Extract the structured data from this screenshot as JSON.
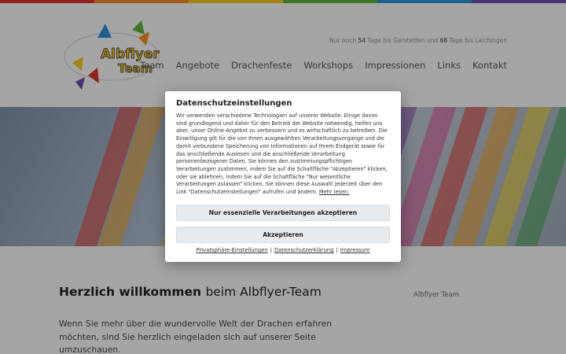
{
  "colors": {
    "rainbow": [
      "#d9322a",
      "#f08a24",
      "#f2c31b",
      "#5fae3a",
      "#2f8fd0",
      "#6b4aa6"
    ],
    "hero_stripes": [
      "#e03a2f",
      "#f3a125",
      "#f2d01c",
      "#3fa34d",
      "#2f7fd0",
      "#8a4ab0",
      "#d94e8f"
    ]
  },
  "header": {
    "logo_text_line1": "Albflyer",
    "logo_text_line2": "Team",
    "countdown": {
      "prefix": "Nur noch",
      "days1": "54",
      "middle": "Tage bis Gerstetten und",
      "days2": "68",
      "suffix": "Tage bis Laichingen"
    },
    "nav": [
      "Team",
      "Angebote",
      "Drachenfeste",
      "Workshops",
      "Impressionen",
      "Links",
      "Kontakt"
    ]
  },
  "content": {
    "welcome_bold": "Herzlich willkommen",
    "welcome_rest": "beim Albflyer-Team",
    "sidebar_link": "Albflyer Team",
    "intro": "Wenn Sie mehr über die wundervolle Welt der Drachen erfahren möchten, sind Sie herzlich eingeladen sich auf unserer Seite umzuschauen."
  },
  "modal": {
    "title": "Datenschutzeinstellungen",
    "text": "Wir verwenden verschiedene Technologien auf unserer Website. Einige davon sind grundlegend und daher für den Betrieb der Website notwendig, helfen uns aber, unser Online-Angebot zu verbessern und es wirtschaftlich zu betreiben. Die Einwilligung gilt für die von Ihnen ausgewählten Verarbeitungsvorgänge und die damit verbundene Speicherung von Informationen auf Ihrem Endgerät sowie für das anschließende Auslesen und die anschließende Verarbeitung personenbezogener Daten. Sie können den zustimmungspflichtigen Verarbeitungen zustimmen, indem Sie auf die Schaltfläche \"Akzeptieren\" klicken, oder sie ablehnen, indem Sie auf die Schaltfläche \"Nur wesentliche Verarbeitungen zulassen\" klicken. Sie können diese Auswahl jederzeit über den Link \"Datenschutzeinstellungen\" aufrufen und ändern.",
    "more_link": "Mehr lesen.",
    "btn_essential": "Nur essenzielle Verarbeitungen akzeptieren",
    "btn_accept": "Akzeptieren",
    "links": [
      "Privatsphäre-Einstellungen",
      "Datenschutzerklärung",
      "Impressum"
    ]
  }
}
